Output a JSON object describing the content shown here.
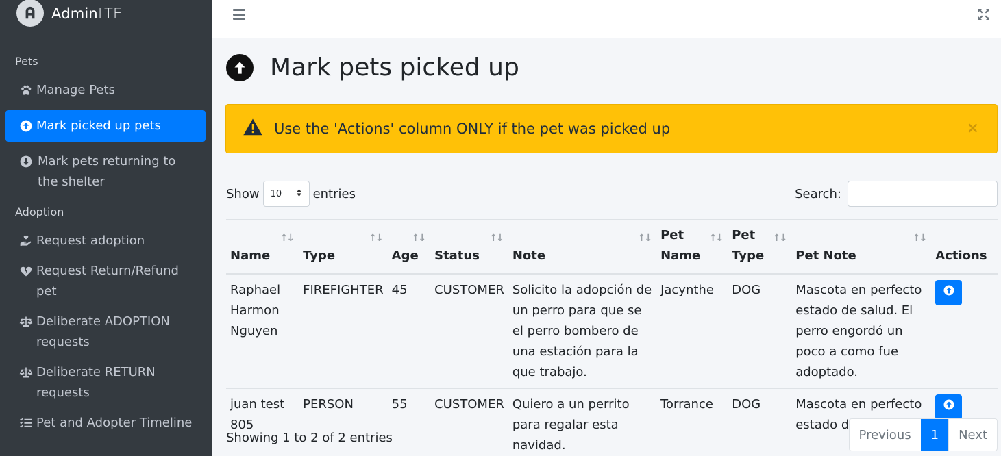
{
  "brand": {
    "name_bold": "Admin",
    "name_light": "LTE"
  },
  "sidebar": {
    "sections": [
      {
        "header": "Pets",
        "items": [
          {
            "label": "Manage Pets",
            "icon": "paw-icon",
            "active": false
          },
          {
            "label": "Mark picked up pets",
            "icon": "arrow-circle-up-icon",
            "active": true
          },
          {
            "label": "Mark pets returning to the shelter",
            "icon": "arrow-circle-down-icon",
            "active": false
          }
        ]
      },
      {
        "header": "Adoption",
        "items": [
          {
            "label": "Request adoption",
            "icon": "hand-holding-heart-icon",
            "active": false
          },
          {
            "label": "Request Return/Refund pet",
            "icon": "heart-broken-icon",
            "active": false
          },
          {
            "label": "Deliberate ADOPTION requests",
            "icon": "balance-scale-icon",
            "active": false
          },
          {
            "label": "Deliberate RETURN requests",
            "icon": "balance-scale-icon",
            "active": false
          },
          {
            "label": "Pet and Adopter Timeline",
            "icon": "list-check-icon",
            "active": false
          }
        ]
      }
    ]
  },
  "page": {
    "title": "Mark pets picked up"
  },
  "alert": {
    "text": "Use the 'Actions' column ONLY if the pet was picked up",
    "close": "×"
  },
  "table_controls": {
    "show_label": "Show",
    "entries_value": "10",
    "entries_label": "entries",
    "search_label": "Search:",
    "search_value": ""
  },
  "table": {
    "columns": [
      "Name",
      "Type",
      "Age",
      "Status",
      "Note",
      "Pet Name",
      "Pet Type",
      "Pet Note",
      "Actions"
    ],
    "rows": [
      [
        "Raphael Harmon Nguyen",
        "FIREFIGHTER",
        "45",
        "CUSTOMER",
        "Solicito la adopción de un perro para que se el perro bombero de una estación para la que trabajo.",
        "Jacynthe",
        "DOG",
        "Mascota en perfecto estado de salud. El perro engordó un poco a como fue adoptado."
      ],
      [
        "juan test 805",
        "PERSON",
        "55",
        "CUSTOMER",
        "Quiero a un perrito para regalar esta navidad.",
        "Torrance",
        "DOG",
        "Mascota en perfecto estado de salud"
      ]
    ]
  },
  "footer": {
    "info": "Showing 1 to 2 of 2 entries",
    "previous": "Previous",
    "current_page": "1",
    "next": "Next"
  },
  "colors": {
    "primary": "#007bff",
    "warning": "#ffc107",
    "sidebar": "#343a40"
  }
}
